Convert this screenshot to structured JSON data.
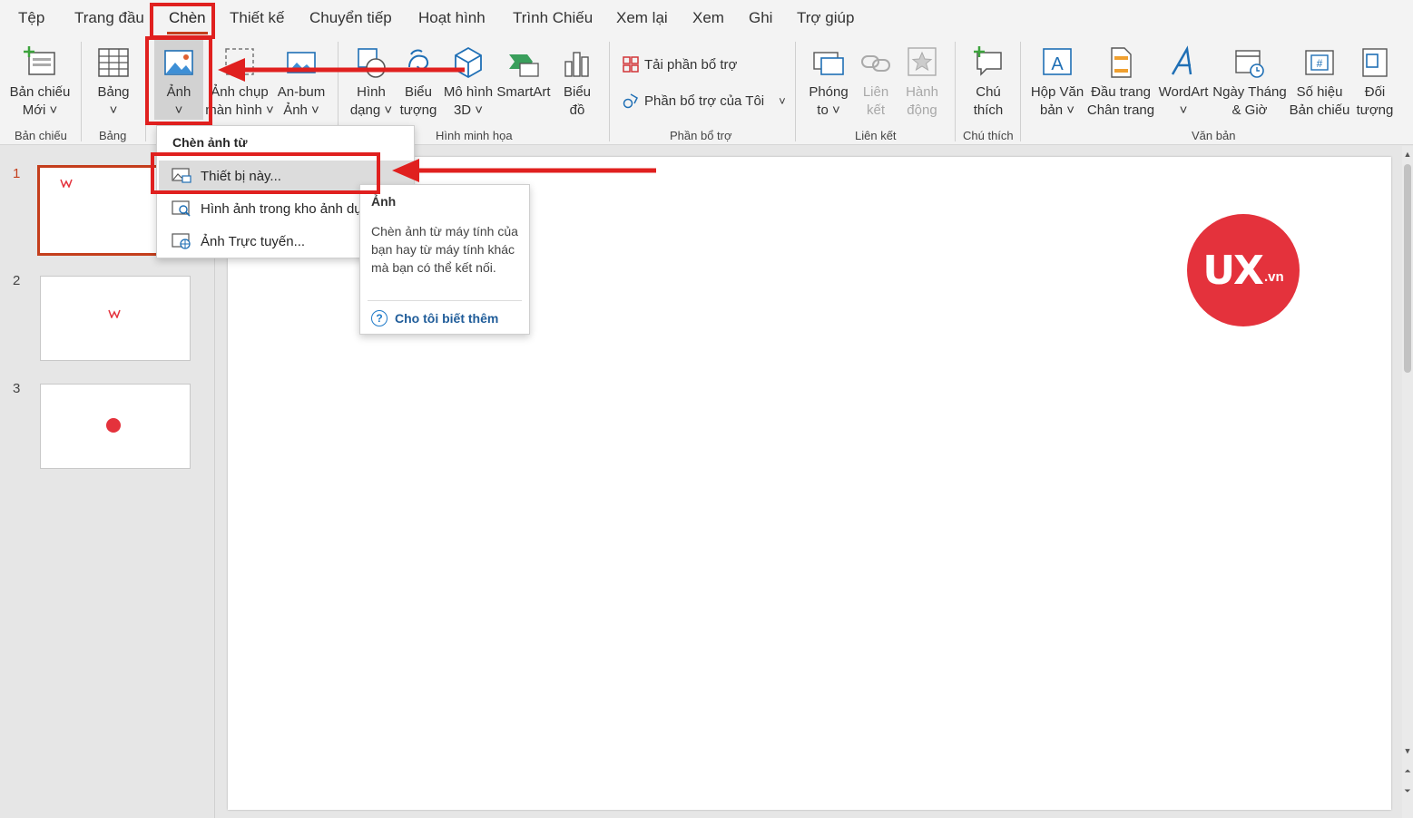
{
  "tabs": [
    "Tệp",
    "Trang đầu",
    "Chèn",
    "Thiết kế",
    "Chuyển tiếp",
    "Hoạt hình",
    "Trình Chiếu",
    "Xem lại",
    "Xem",
    "Ghi",
    "Trợ giúp"
  ],
  "ribbon": {
    "new_slide": "Bản chiếu\nMới ˅",
    "table": "Bảng\n˅",
    "pictures": "Ảnh\n˅",
    "screenshot": "Ảnh chụp\nmàn hình ˅",
    "album": "An-bum\nẢnh ˅",
    "shapes": "Hình\ndạng ˅",
    "icons": "Biểu\ntượng",
    "models3d": "Mô hình\n3D ˅",
    "smartart": "SmartArt",
    "chart": "Biểu\nđồ",
    "get_addins": "Tải phần bổ trợ",
    "my_addins": "Phần bổ trợ của Tôi",
    "zoom": "Phóng\nto ˅",
    "link": "Liên\nkết",
    "action": "Hành\nđộng",
    "comment": "Chú\nthích",
    "textbox": "Hộp Văn\nbản ˅",
    "header_footer": "Đầu trang\nChân trang",
    "wordart": "WordArt\n˅",
    "datetime": "Ngày Tháng\n& Giờ",
    "slide_number": "Số hiệu\nBản chiếu",
    "object": "Đối\ntượng",
    "groups": {
      "slides": "Bản chiếu",
      "tables": "Bảng",
      "illustrations": "Hình minh họa",
      "addins": "Phần bổ trợ",
      "links": "Liên kết",
      "comments": "Chú thích",
      "text": "Văn bản"
    }
  },
  "menu": {
    "header": "Chèn ảnh từ",
    "items": [
      "Thiết bị này...",
      "Hình ảnh trong kho ảnh dự",
      "Ảnh Trực tuyến..."
    ]
  },
  "tooltip": {
    "title": "Ảnh",
    "description": "Chèn ảnh từ máy tính của bạn hay từ máy tính khác mà bạn có thể kết nối.",
    "link": "Cho tôi biết thêm"
  },
  "slides": [
    "1",
    "2",
    "3"
  ],
  "logo": {
    "big": "UX",
    "small": ".vn"
  },
  "colors": {
    "accent": "#c43e1c",
    "annotation": "#e0201f",
    "logo": "#e4323c"
  }
}
